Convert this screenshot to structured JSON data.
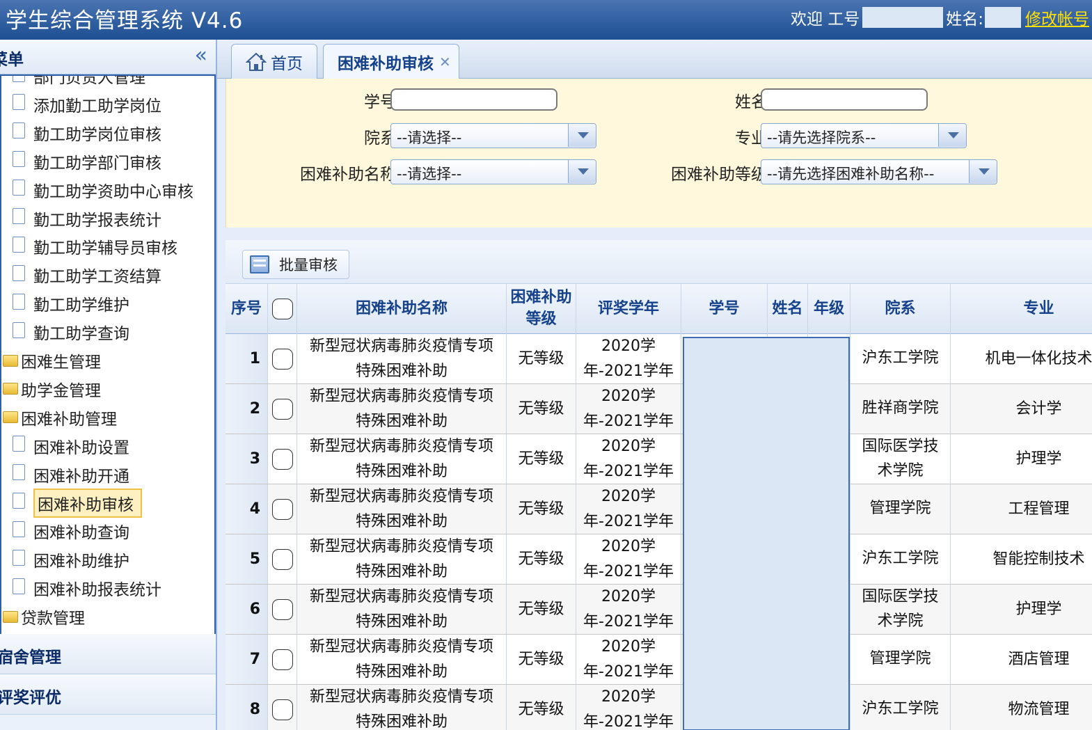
{
  "header": {
    "title": "学生综合管理系统 V4.6",
    "welcome_text": "欢迎 工号",
    "name_label": "姓名:",
    "change_account": "修改帐号"
  },
  "sidebar": {
    "title": "菜单",
    "collapse_icon": "double-chevron-left-icon",
    "tree_items": [
      {
        "label": "部门负责人管理",
        "type": "leaf"
      },
      {
        "label": "添加勤工助学岗位",
        "type": "leaf"
      },
      {
        "label": "勤工助学岗位审核",
        "type": "leaf"
      },
      {
        "label": "勤工助学部门审核",
        "type": "leaf"
      },
      {
        "label": "勤工助学资助中心审核",
        "type": "leaf"
      },
      {
        "label": "勤工助学报表统计",
        "type": "leaf"
      },
      {
        "label": "勤工助学辅导员审核",
        "type": "leaf"
      },
      {
        "label": "勤工助学工资结算",
        "type": "leaf"
      },
      {
        "label": "勤工助学维护",
        "type": "leaf"
      },
      {
        "label": "勤工助学查询",
        "type": "leaf"
      },
      {
        "label": "困难生管理",
        "type": "folder"
      },
      {
        "label": "助学金管理",
        "type": "folder"
      },
      {
        "label": "困难补助管理",
        "type": "folder"
      },
      {
        "label": "困难补助设置",
        "type": "leaf"
      },
      {
        "label": "困难补助开通",
        "type": "leaf"
      },
      {
        "label": "困难补助审核",
        "type": "leaf",
        "selected": true
      },
      {
        "label": "困难补助查询",
        "type": "leaf"
      },
      {
        "label": "困难补助维护",
        "type": "leaf"
      },
      {
        "label": "困难补助报表统计",
        "type": "leaf"
      },
      {
        "label": "贷款管理",
        "type": "folder"
      }
    ],
    "sections": [
      "宿舍管理",
      "评奖评优"
    ]
  },
  "tabs": [
    {
      "label": "首页",
      "icon": "home-icon"
    },
    {
      "label": "困难补助审核",
      "close_icon": "close-icon"
    }
  ],
  "search": {
    "student_id_label": "学号",
    "student_id_value": "",
    "name_label": "姓名",
    "name_value": "",
    "college_label": "院系",
    "college_value": "--请选择--",
    "major_label": "专业",
    "major_value": "--请先选择院系--",
    "subsidy_name_label": "困难补助名称",
    "subsidy_name_value": "--请选择--",
    "subsidy_level_label": "困难补助等级",
    "subsidy_level_value": "--请先选择困难补助名称--"
  },
  "toolbar": {
    "batch_label": "批量审核"
  },
  "grid": {
    "columns": [
      "序号",
      "",
      "困难补助名称",
      "困难补助等级",
      "评奖学年",
      "学号",
      "姓名",
      "年级",
      "院系",
      "专业"
    ],
    "rows": [
      {
        "no": "1",
        "name_line1": "新型冠状病毒肺炎疫情专项",
        "name_line2": "特殊困难补助",
        "level": "无等级",
        "year_line1": "2020学",
        "year_line2": "年-2021学年",
        "college": "沪东工学院",
        "major": "机电一体化技术"
      },
      {
        "no": "2",
        "name_line1": "新型冠状病毒肺炎疫情专项",
        "name_line2": "特殊困难补助",
        "level": "无等级",
        "year_line1": "2020学",
        "year_line2": "年-2021学年",
        "college": "胜祥商学院",
        "major": "会计学"
      },
      {
        "no": "3",
        "name_line1": "新型冠状病毒肺炎疫情专项",
        "name_line2": "特殊困难补助",
        "level": "无等级",
        "year_line1": "2020学",
        "year_line2": "年-2021学年",
        "college": "国际医学技术学院",
        "major": "护理学"
      },
      {
        "no": "4",
        "name_line1": "新型冠状病毒肺炎疫情专项",
        "name_line2": "特殊困难补助",
        "level": "无等级",
        "year_line1": "2020学",
        "year_line2": "年-2021学年",
        "college": "管理学院",
        "major": "工程管理"
      },
      {
        "no": "5",
        "name_line1": "新型冠状病毒肺炎疫情专项",
        "name_line2": "特殊困难补助",
        "level": "无等级",
        "year_line1": "2020学",
        "year_line2": "年-2021学年",
        "college": "沪东工学院",
        "major": "智能控制技术"
      },
      {
        "no": "6",
        "name_line1": "新型冠状病毒肺炎疫情专项",
        "name_line2": "特殊困难补助",
        "level": "无等级",
        "year_line1": "2020学",
        "year_line2": "年-2021学年",
        "college": "国际医学技术学院",
        "major": "护理学"
      },
      {
        "no": "7",
        "name_line1": "新型冠状病毒肺炎疫情专项",
        "name_line2": "特殊困难补助",
        "level": "无等级",
        "year_line1": "2020学",
        "year_line2": "年-2021学年",
        "college": "管理学院",
        "major": "酒店管理"
      },
      {
        "no": "8",
        "name_line1": "新型冠状病毒肺炎疫情专项",
        "name_line2": "特殊困难补助",
        "level": "无等级",
        "year_line1": "2020学",
        "year_line2": "年-2021学年",
        "college": "沪东工学院",
        "major": "物流管理"
      }
    ]
  },
  "colors": {
    "header_blue": "#1d4f92",
    "link_yellow": "#ffe000",
    "search_bg": "#fff8dc",
    "selected_bg": "#fff0c2"
  }
}
